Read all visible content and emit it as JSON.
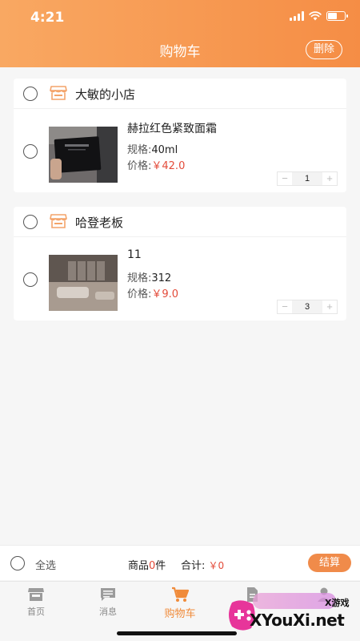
{
  "status_bar": {
    "time": "4:21"
  },
  "header": {
    "title": "购物车",
    "delete_label": "删除"
  },
  "shops": [
    {
      "name": "大敏的小店",
      "items": [
        {
          "name": "赫拉红色紧致面霜",
          "spec_label": "规格:",
          "spec": "40ml",
          "price_label": "价格:",
          "price": "￥42.0",
          "quantity": "1"
        }
      ]
    },
    {
      "name": "哈登老板",
      "items": [
        {
          "name": "11",
          "spec_label": "规格:",
          "spec": "312",
          "price_label": "价格:",
          "price": "￥9.0",
          "quantity": "3"
        }
      ]
    }
  ],
  "stepper": {
    "minus": "−",
    "plus": "+"
  },
  "summary": {
    "select_all": "全选",
    "goods_prefix": "商品",
    "goods_count": "0",
    "goods_suffix": "件",
    "total_label": "合计:",
    "total_value": "￥0",
    "checkout_label": "结算"
  },
  "tabbar": {
    "items": [
      {
        "label": "首页",
        "icon": "shop-icon"
      },
      {
        "label": "消息",
        "icon": "message-icon"
      },
      {
        "label": "购物车",
        "icon": "cart-icon",
        "active": true
      },
      {
        "label": "",
        "icon": "document-icon"
      },
      {
        "label": "",
        "icon": "user-icon"
      }
    ]
  },
  "watermark": {
    "small_text": "X游戏",
    "big_text": "XYouXi.net"
  },
  "colors": {
    "accent": "#f58d45",
    "price": "#e34b3a",
    "tab_active": "#f08b3a"
  }
}
